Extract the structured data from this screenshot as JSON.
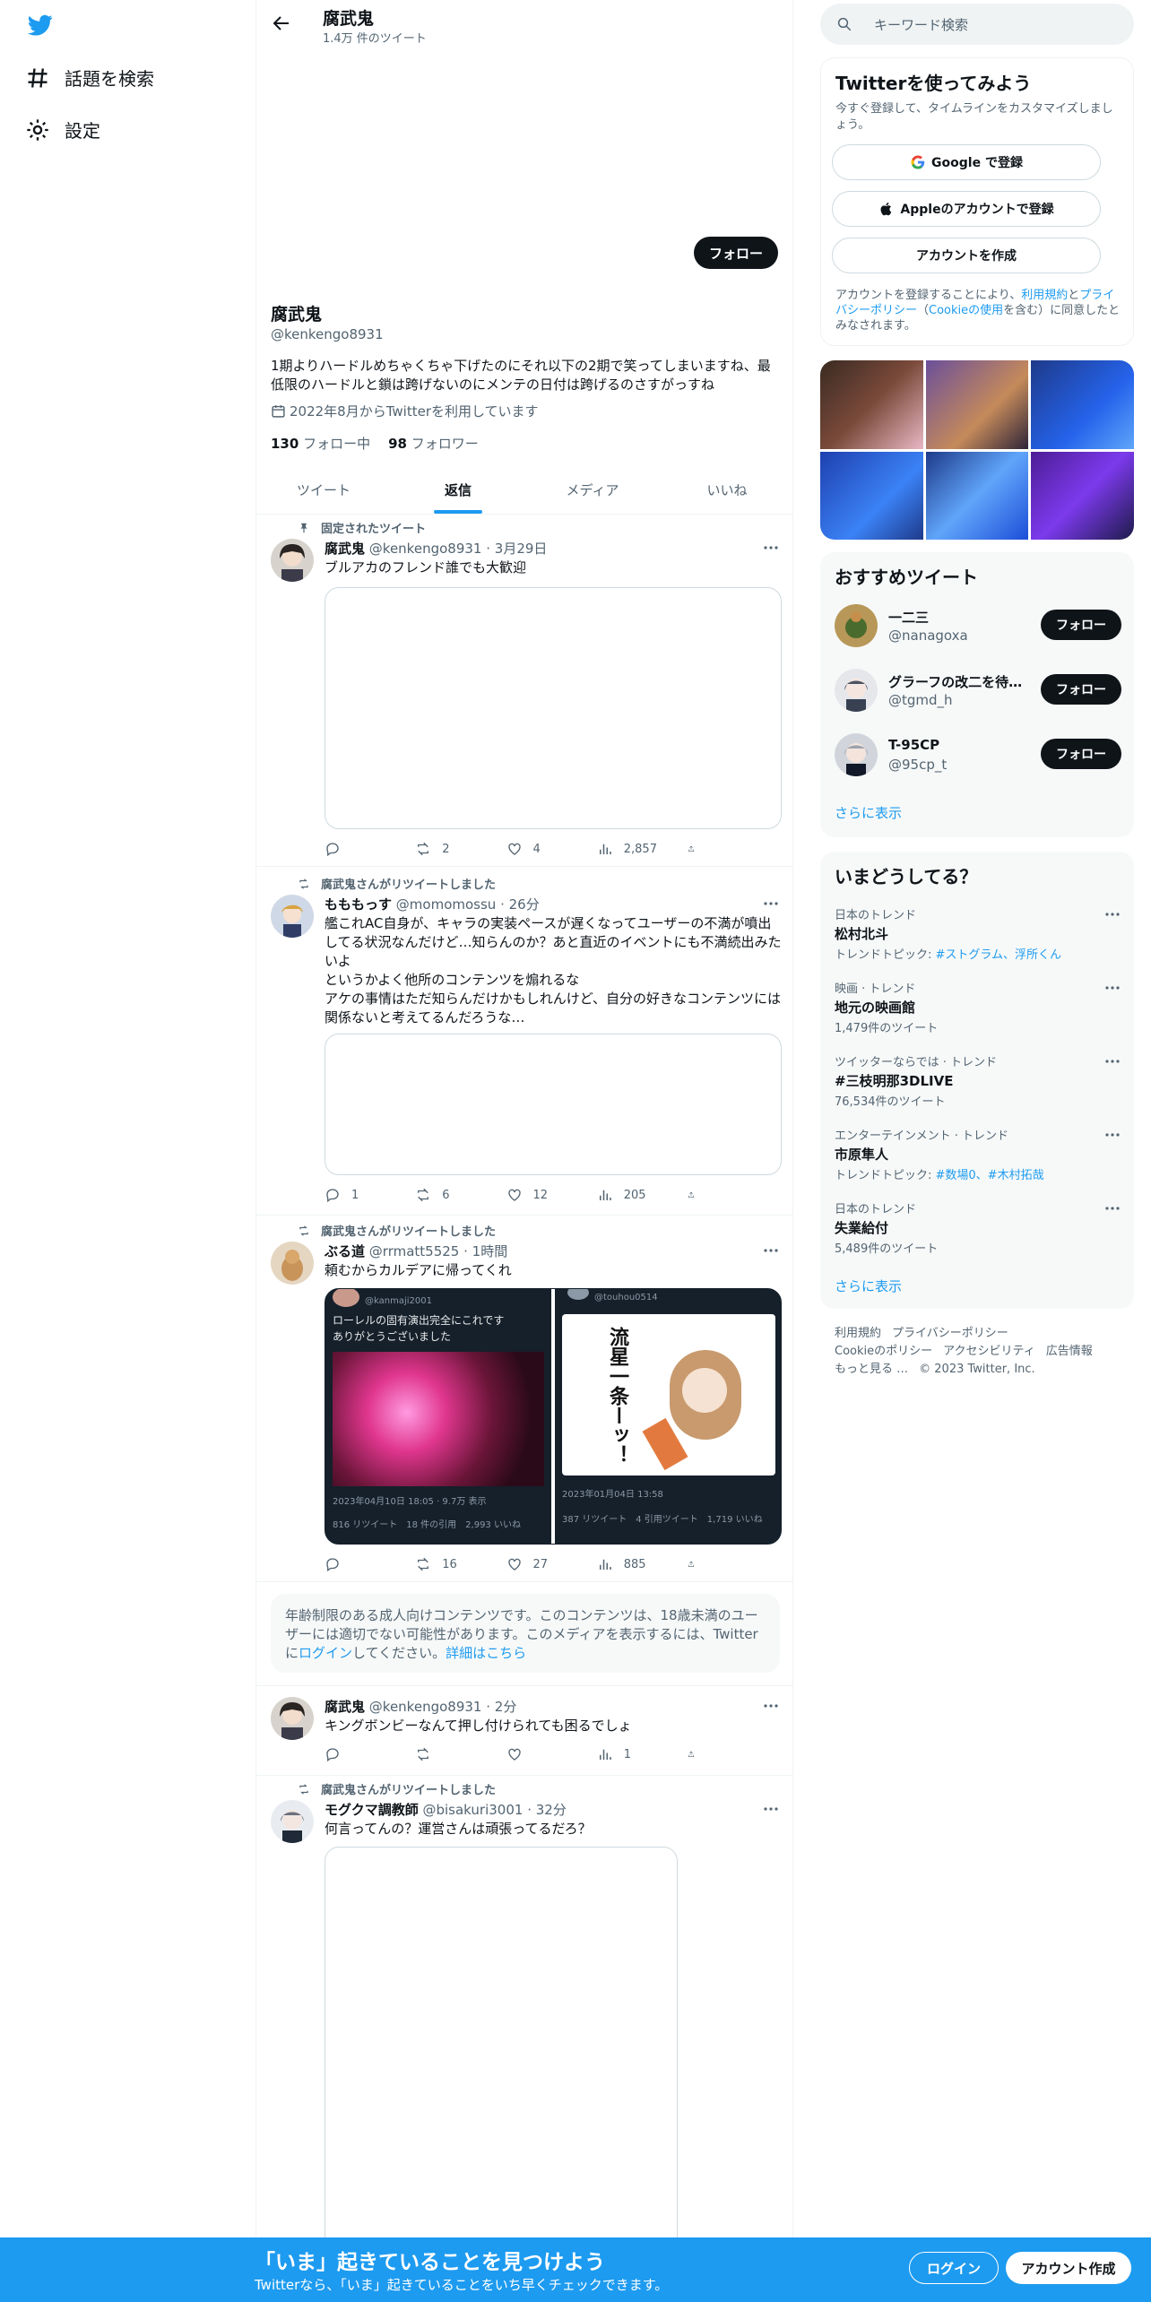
{
  "nav": {
    "items": [
      {
        "label": "話題を検索",
        "icon": "hashtag-icon"
      },
      {
        "label": "設定",
        "icon": "gear-icon"
      }
    ]
  },
  "header": {
    "name": "腐武鬼",
    "tweet_count": "1.4万 件のツイート"
  },
  "profile": {
    "follow_label": "フォロー",
    "name": "腐武鬼",
    "handle": "@kenkengo8931",
    "bio": "1期よりハードルめちゃくちゃ下げたのにそれ以下の2期で笑ってしまいますね、最低限のハードルと鎖は跨げないのにメンテの日付は跨げるのさすがっすね",
    "joined": "2022年8月からTwitterを利用しています",
    "following_count": "130",
    "following_label": "フォロー中",
    "followers_count": "98",
    "followers_label": "フォロワー"
  },
  "tabs": [
    {
      "label": "ツイート",
      "active": false
    },
    {
      "label": "返信",
      "active": true
    },
    {
      "label": "メディア",
      "active": false
    },
    {
      "label": "いいね",
      "active": false
    }
  ],
  "tweets": [
    {
      "context": "固定されたツイート",
      "name": "腐武鬼",
      "handle": "@kenkengo8931",
      "time": "· 3月29日",
      "text": "ブルアカのフレンド誰でも大歓迎",
      "replies": "",
      "retweets": "2",
      "likes": "4",
      "views": "2,857"
    },
    {
      "context": "腐武鬼さんがリツイートしました",
      "name": "もももっす",
      "handle": "@momomossu",
      "time": "· 26分",
      "text": "艦これAC自身が、キャラの実装ペースが遅くなってユーザーの不満が噴出してる状況なんだけど…知らんのか？あと直近のイベントにも不満続出みたいよ\nというかよく他所のコンテンツを煽れるな\nアケの事情はただ知らんだけかもしれんけど、自分の好きなコンテンツには関係ないと考えてるんだろうな…",
      "replies": "1",
      "retweets": "6",
      "likes": "12",
      "views": "205"
    },
    {
      "context": "腐武鬼さんがリツイートしました",
      "name": "ぶる道",
      "handle": "@rrmatt5525",
      "time": "· 1時間",
      "text": "頼むからカルデアに帰ってくれ",
      "replies": "",
      "retweets": "16",
      "likes": "27",
      "views": "885",
      "embed_left": {
        "author": "@kanmaji2001",
        "text": "ローレルの固有演出完全にこれです\nありがとうございました",
        "date": "2023年04月10日 18:05 · 9.7万 表示",
        "stats": "816 リツイート　18 件の引用　2,993 いいね"
      },
      "embed_right": {
        "author": "@touhou0514",
        "art_text": "流星一条ーッ！",
        "date": "2023年01月04日 13:58",
        "stats": "387 リツイート　4 引用ツイート　1,719 いいね"
      }
    },
    {
      "context": "",
      "name": "腐武鬼",
      "handle": "@kenkengo8931",
      "time": "· 2分",
      "text": "キングボンビーなんて押し付けられても困るでしょ",
      "replies": "",
      "retweets": "",
      "likes": "",
      "views": "1"
    },
    {
      "context": "腐武鬼さんがリツイートしました",
      "name": "モグクマ調教師",
      "handle": "@bisakuri3001",
      "time": "· 32分",
      "text": "何言ってんの？運営さんは頑張ってるだろ？"
    }
  ],
  "notice": {
    "text": "年齢制限のある成人向けコンテンツです。このコンテンツは、18歳未満のユーザーには適切でない可能性があります。このメディアを表示するには、Twitterに",
    "login_link": "ログイン",
    "text2": "してください。",
    "details_link": "詳細はこちら"
  },
  "search": {
    "placeholder": "キーワード検索"
  },
  "join": {
    "title": "Twitterを使ってみよう",
    "subtitle": "今すぐ登録して、タイムラインをカスタマイズしましょう。",
    "google": "Google で登録",
    "apple": "Appleのアカウントで登録",
    "create": "アカウントを作成",
    "legal_1": "アカウントを登録することにより、",
    "legal_terms": "利用規約",
    "legal_2": "と",
    "legal_privacy": "プライバシーポリシー",
    "legal_3": "（",
    "legal_cookie": "Cookieの使用",
    "legal_4": "を含む）に同意したとみなされます。"
  },
  "suggestions": {
    "title": "おすすめツイート",
    "follow_label": "フォロー",
    "items": [
      {
        "name": "一二三",
        "handle": "@nanagoxa"
      },
      {
        "name": "グラーフの改二を待…",
        "handle": "@tgmd_h"
      },
      {
        "name": "T-95CP",
        "handle": "@95cp_t"
      }
    ],
    "more": "さらに表示"
  },
  "trends": {
    "title": "いまどうしてる？",
    "items": [
      {
        "category": "日本のトレンド",
        "name": "松村北斗",
        "meta_prefix": "トレンドトピック: ",
        "meta_links": "#ストグラム、浮所くん"
      },
      {
        "category": "映画 · トレンド",
        "name": "地元の映画館",
        "meta_prefix": "1,479件のツイート",
        "meta_links": ""
      },
      {
        "category": "ツイッターならでは · トレンド",
        "name": "#三枝明那3DLIVE",
        "meta_prefix": "76,534件のツイート",
        "meta_links": ""
      },
      {
        "category": "エンターテインメント · トレンド",
        "name": "市原隼人",
        "meta_prefix": "トレンドトピック: ",
        "meta_links": "#数場0、#木村拓哉"
      },
      {
        "category": "日本のトレンド",
        "name": "失業給付",
        "meta_prefix": "5,489件のツイート",
        "meta_links": ""
      }
    ],
    "more": "さらに表示"
  },
  "footer": {
    "links": [
      "利用規約",
      "プライバシーポリシー",
      "Cookieのポリシー",
      "アクセシビリティ",
      "広告情報",
      "もっと見る …"
    ],
    "copyright": "© 2023 Twitter, Inc."
  },
  "bottombar": {
    "title": "「いま」起きていることを見つけよう",
    "subtitle": "Twitterなら、「いま」起きていることをいち早くチェックできます。",
    "login": "ログイン",
    "signup": "アカウント作成"
  },
  "colors": {
    "accent": "#1d9bf0",
    "text": "#0f1419",
    "muted": "#536471",
    "button": "#0f1419"
  }
}
